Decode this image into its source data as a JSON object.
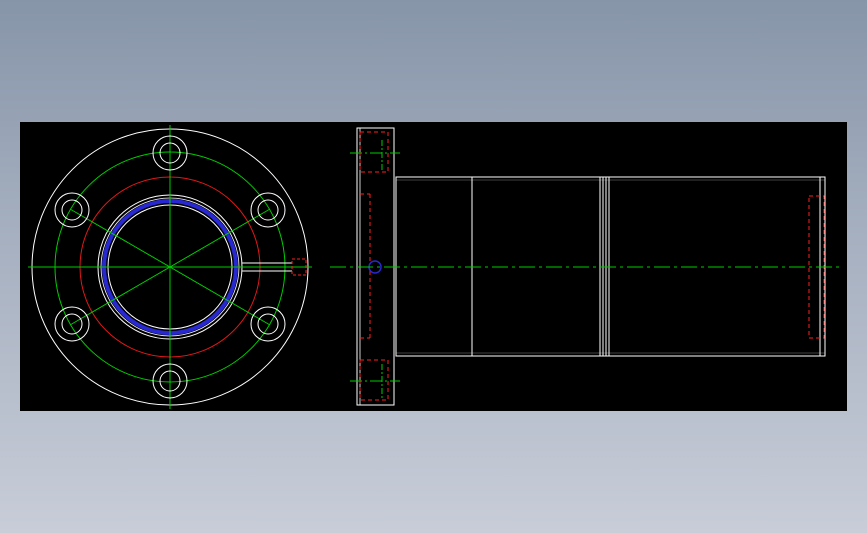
{
  "drawing": {
    "background": "#000000",
    "colors": {
      "outline": "#ffffff",
      "centerline": "#00cc00",
      "hidden": "#ff2020",
      "pitch_red": "#e01818",
      "highlight": "#2828d0"
    },
    "views": [
      "front-view-flange",
      "side-view-bushing"
    ]
  }
}
